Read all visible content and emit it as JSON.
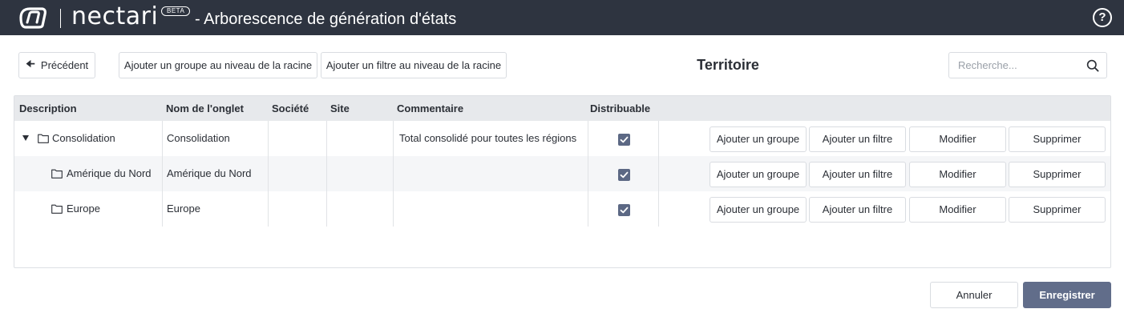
{
  "header": {
    "brand": "nectari",
    "beta_badge": "BETA",
    "title": "- Arborescence de génération d'états",
    "help_icon": "help-circle-icon"
  },
  "toolbar": {
    "back_label": "Précédent",
    "add_root_group_label": "Ajouter un groupe au niveau de la racine",
    "add_root_filter_label": "Ajouter un filtre au niveau de la racine",
    "section_title": "Territoire",
    "search_placeholder": "Recherche..."
  },
  "table": {
    "columns": [
      "Description",
      "Nom de l'onglet",
      "Société",
      "Site",
      "Commentaire",
      "Distribuable"
    ],
    "rows": [
      {
        "description": "Consolidation",
        "tab_name": "Consolidation",
        "company": "",
        "site": "",
        "comment": "Total consolidé pour toutes les régions",
        "distributable": true,
        "expanded": true,
        "level": 0
      },
      {
        "description": "Amérique du Nord",
        "tab_name": "Amérique du Nord",
        "company": "",
        "site": "",
        "comment": "",
        "distributable": true,
        "level": 1
      },
      {
        "description": "Europe",
        "tab_name": "Europe",
        "company": "",
        "site": "",
        "comment": "",
        "distributable": true,
        "level": 1
      }
    ],
    "row_actions": {
      "add_group": "Ajouter un groupe",
      "add_filter": "Ajouter un filtre",
      "edit": "Modifier",
      "delete": "Supprimer"
    }
  },
  "footer": {
    "cancel_label": "Annuler",
    "save_label": "Enregistrer"
  },
  "colors": {
    "header_bg": "#2e3440",
    "table_header_bg": "#e7e9ec",
    "alt_row_bg": "#f5f6f8",
    "checkbox": "#5c6884",
    "primary_button": "#616d8a"
  }
}
